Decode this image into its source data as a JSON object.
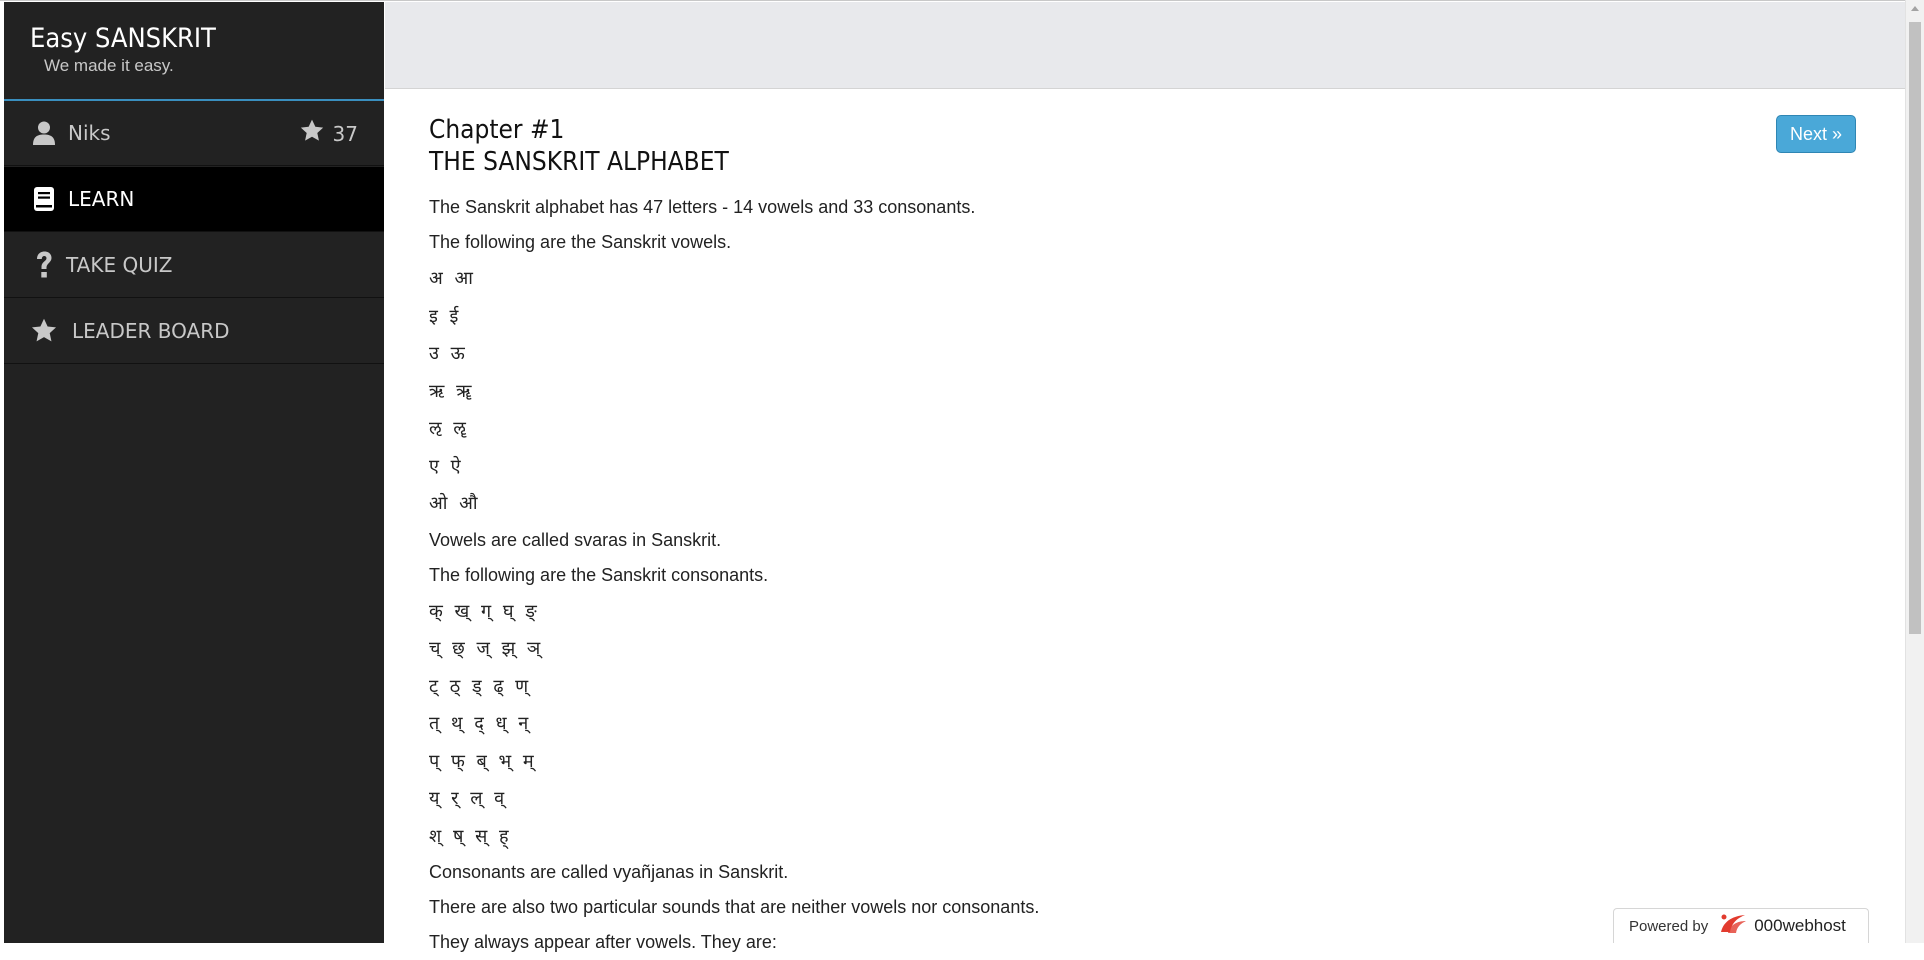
{
  "app": {
    "title": "Easy SANSKRIT",
    "tagline": "We made it easy."
  },
  "user": {
    "name": "Niks",
    "score": "37"
  },
  "nav": {
    "learn": "LEARN",
    "quiz": "TAKE QUIZ",
    "leaderboard": "LEADER BOARD"
  },
  "main": {
    "chapter": "Chapter #1",
    "subtitle": "THE SANSKRIT ALPHABET",
    "next_label": "Next »",
    "lines": {
      "p1": "The Sanskrit alphabet has 47 letters - 14 vowels and 33 consonants.",
      "p2": "The following are the Sanskrit vowels.",
      "v1": "अ आ",
      "v2": "इ ई",
      "v3": "उ ऊ",
      "v4": "ऋ ॠ",
      "v5": "ऌ ॡ",
      "v6": "ए ऐ",
      "v7": "ओ औ",
      "p3": "Vowels are called svaras in Sanskrit.",
      "p4": "The following are the Sanskrit consonants.",
      "c1": "क् ख् ग् घ् ङ्",
      "c2": "च् छ् ज् झ् ञ्",
      "c3": "ट् ठ् ड् ढ् ण्",
      "c4": "त् थ् द् ध् न्",
      "c5": "प् फ् ब् भ् म्",
      "c6": "य् र् ल् व्",
      "c7": "श् ष् स् ह्",
      "p5": "Consonants are called vyañjanas in Sanskrit.",
      "p6": "There are also two particular sounds that are neither vowels nor consonants.",
      "p7": "They always appear after vowels. They are:"
    }
  },
  "footer": {
    "powered_by": "Powered by",
    "host": "000webhost"
  },
  "colors": {
    "sidebar_bg": "#222222",
    "active_bg": "#000000",
    "accent": "#4aa8d8",
    "topbar_bg": "#e8e9ec"
  },
  "icons": {
    "user": "user-icon",
    "star": "star-icon",
    "book": "book-icon",
    "question": "question-icon",
    "leader": "star-icon",
    "host_logo": "000webhost-logo-icon"
  }
}
